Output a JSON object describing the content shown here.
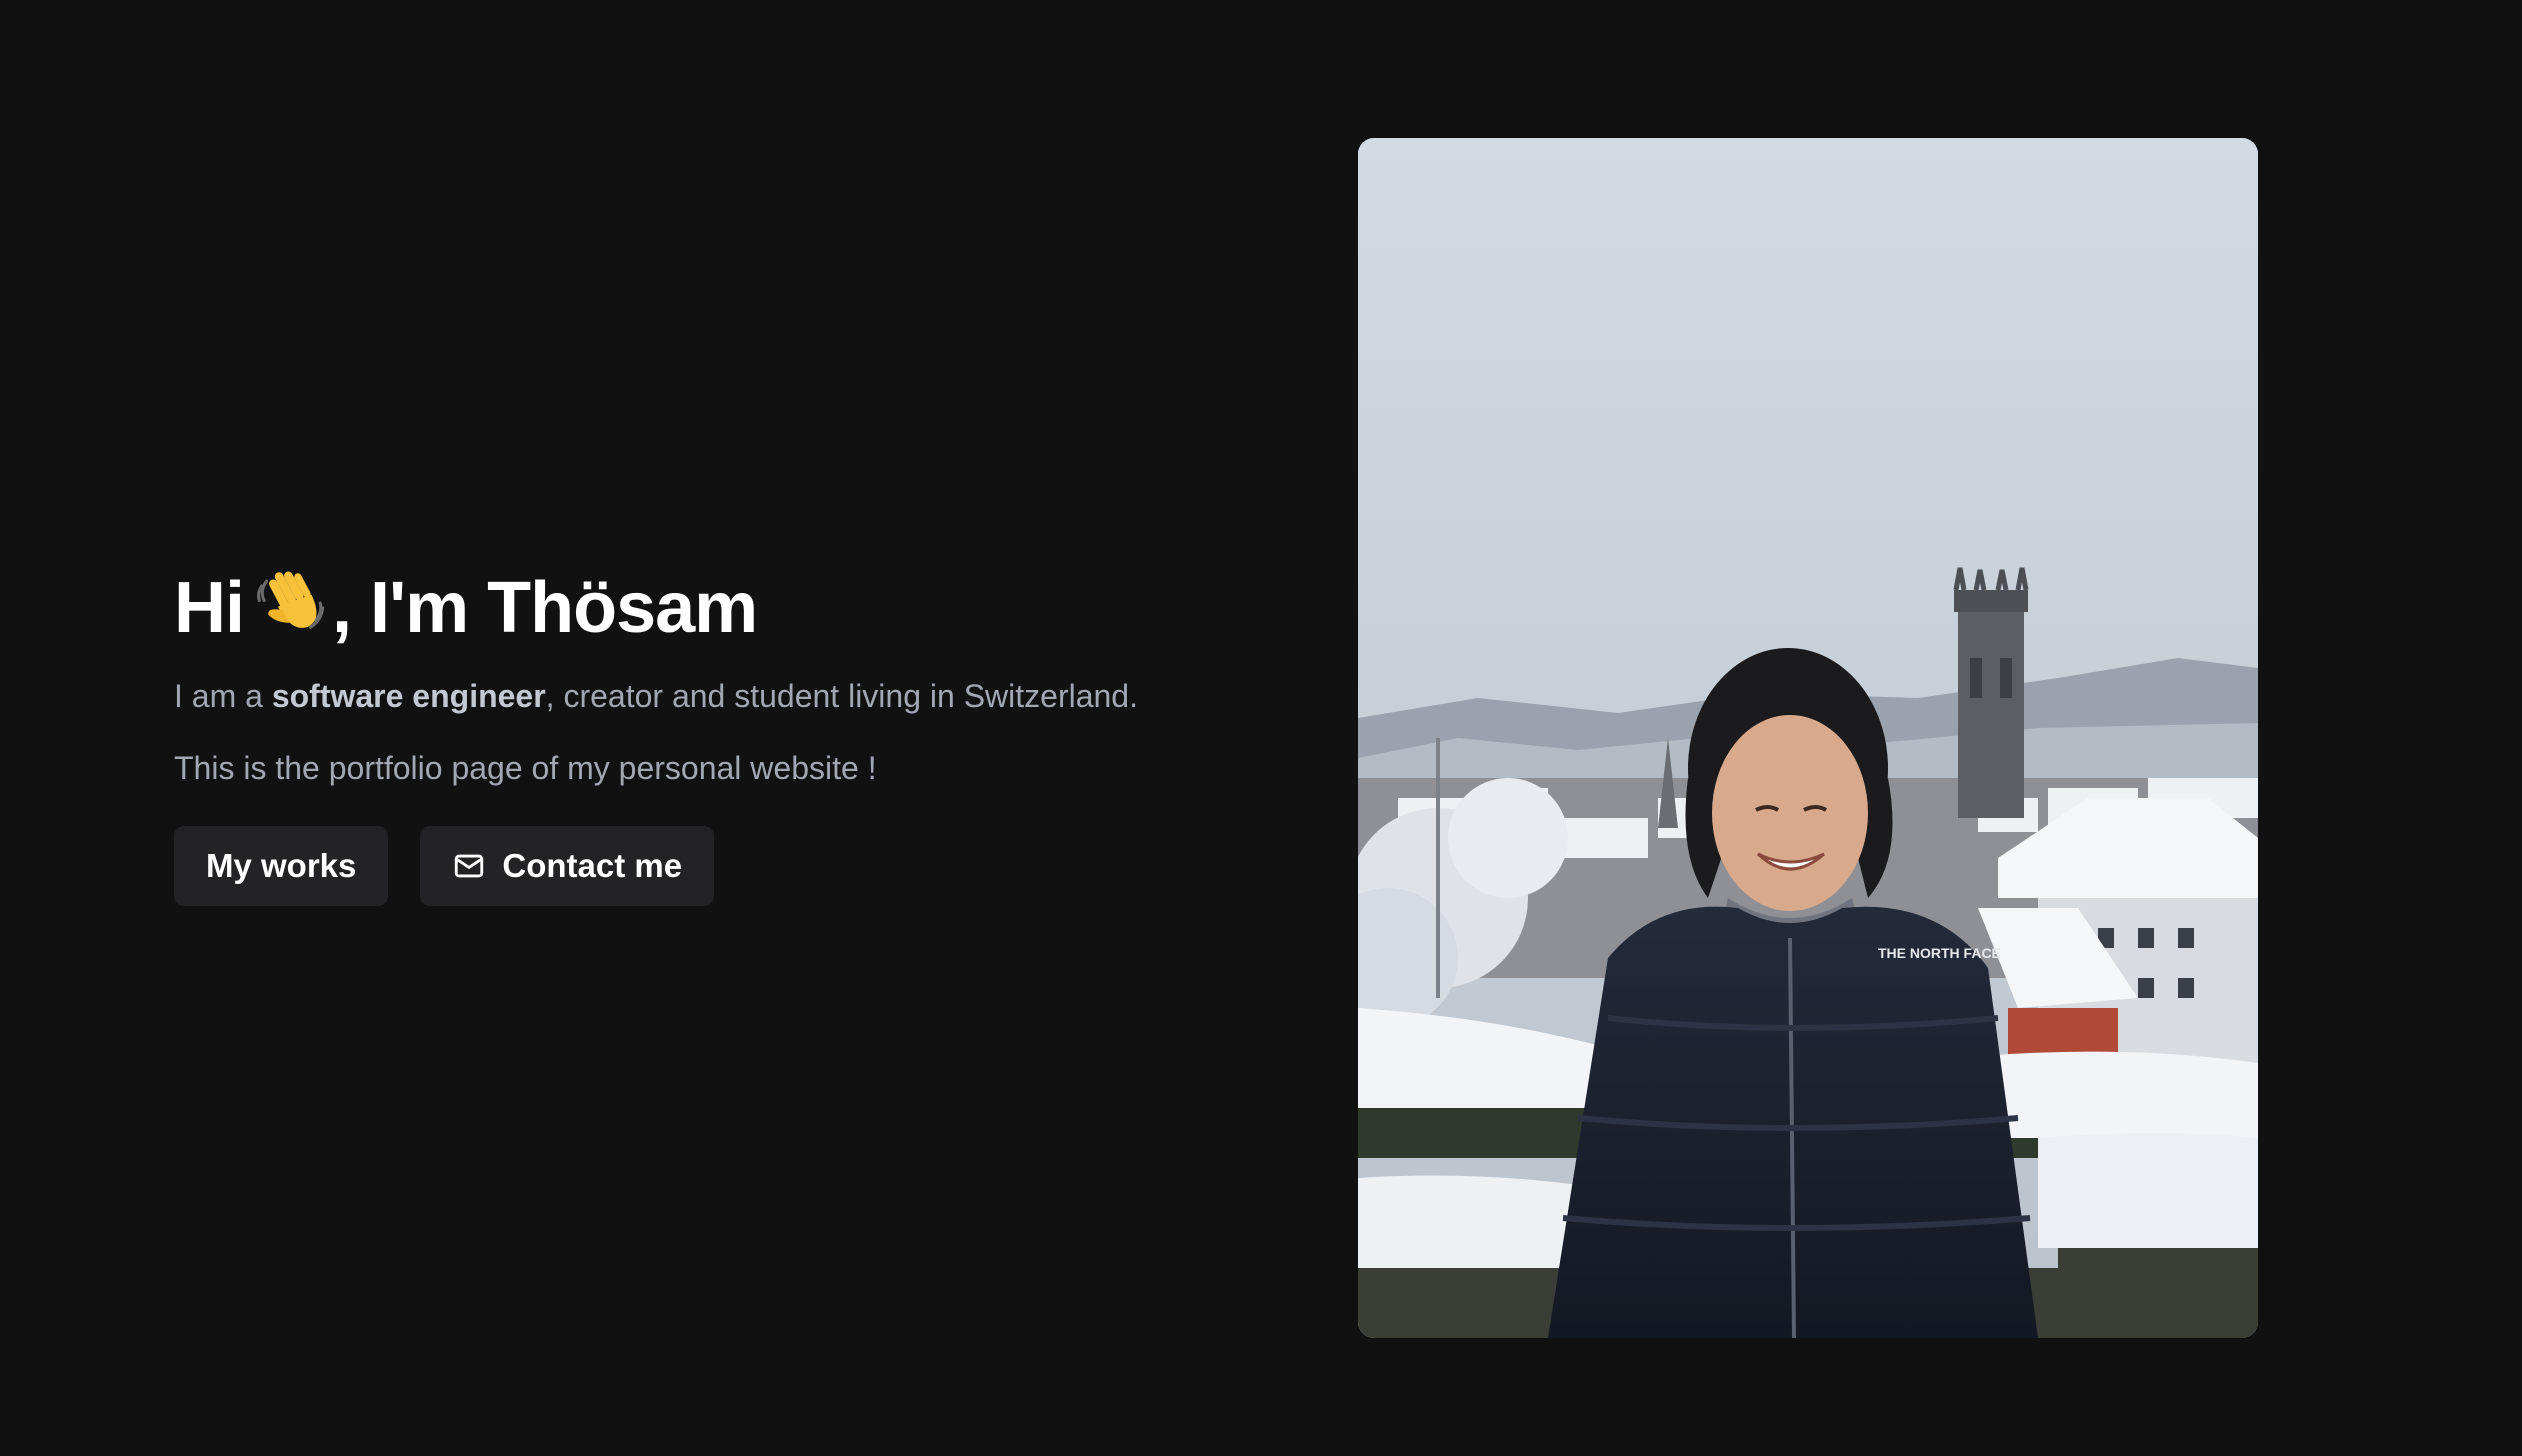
{
  "hero": {
    "greeting": "Hi",
    "wave_emoji_icon": "waving-hand-icon",
    "name_text": ", I'm Thösam",
    "intro_prefix": "I am a ",
    "intro_highlight": "software engineer",
    "intro_suffix": ", creator and student living in Switzerland.",
    "subtitle": "This is the portfolio page of my personal website !"
  },
  "buttons": {
    "works_label": "My works",
    "contact_label": "Contact me",
    "contact_icon": "mail-icon"
  },
  "photo": {
    "alt": "Portrait in snowy city with cathedral tower",
    "jacket_brand_text": "THE NORTH FACE"
  },
  "colors": {
    "background": "#111112",
    "button_bg": "#232325",
    "text_primary": "#ffffff",
    "text_muted": "#a2a7b1"
  }
}
